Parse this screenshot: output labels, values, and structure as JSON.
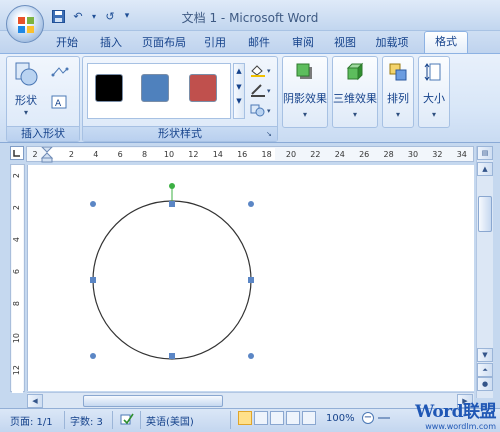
{
  "title": "文档 1 - Microsoft Word",
  "quick_access": {
    "save_icon": "save-icon",
    "undo_icon": "undo-icon",
    "redo_icon": "redo-icon",
    "more_icon": "customize-icon",
    "undo_glyph": "↶",
    "redo_glyph": "↺",
    "more_glyph": "▾"
  },
  "tabs": [
    {
      "label": "开始"
    },
    {
      "label": "插入"
    },
    {
      "label": "页面布局"
    },
    {
      "label": "引用"
    },
    {
      "label": "邮件"
    },
    {
      "label": "审阅"
    },
    {
      "label": "视图"
    },
    {
      "label": "加载项"
    },
    {
      "label": "格式"
    }
  ],
  "ribbon": {
    "insert_shapes_group": "插入形状",
    "shapes_button": "形状",
    "shape_styles_group": "形状样式",
    "style_swatches": [
      {
        "color": "#000000"
      },
      {
        "color": "#4f81bd"
      },
      {
        "color": "#c0504d"
      }
    ],
    "shadow_effects": "阴影效果",
    "three_d_effects": "三维效果",
    "arrange": "排列",
    "size": "大小"
  },
  "ruler": {
    "h_ticks": [
      "2",
      "2",
      "4",
      "6",
      "8",
      "10",
      "12",
      "14",
      "16",
      "18",
      "20",
      "22",
      "24",
      "26",
      "28",
      "30",
      "32",
      "34"
    ],
    "v_ticks": [
      "2",
      "2",
      "4",
      "6",
      "8",
      "10",
      "12"
    ]
  },
  "status": {
    "page": "页面: 1/1",
    "words": "字数: 3",
    "language": "英语(美国)",
    "zoom": "100%",
    "watermark_text": "Word联盟",
    "watermark_url": "www.wordlm.com"
  },
  "colors": {
    "accent": "#15428b",
    "selection_handle": "#5b86c5",
    "rotate_handle": "#3cb043"
  }
}
